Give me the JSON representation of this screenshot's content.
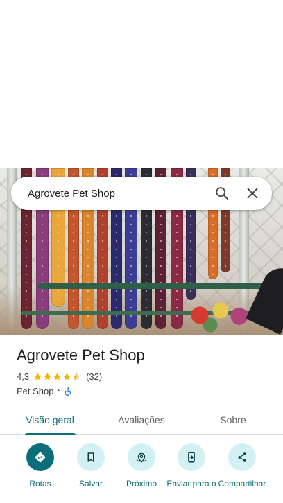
{
  "search": {
    "query": "Agrovete Pet Shop"
  },
  "place": {
    "name": "Agrovete Pet Shop",
    "rating": "4,3",
    "rating_value": 4.3,
    "review_count": "(32)",
    "category": "Pet Shop",
    "separator": "•"
  },
  "tabs": [
    {
      "label": "Visão geral",
      "active": true
    },
    {
      "label": "Avaliações",
      "active": false
    },
    {
      "label": "Sobre",
      "active": false
    }
  ],
  "actions": [
    {
      "label": "Rotas",
      "icon": "directions-icon"
    },
    {
      "label": "Salvar",
      "icon": "bookmark-icon"
    },
    {
      "label": "Próximo",
      "icon": "nearby-icon"
    },
    {
      "label": "Enviar para o",
      "icon": "send-to-phone-icon"
    },
    {
      "label": "Compartilhar",
      "icon": "share-icon"
    }
  ],
  "colors": {
    "accent": "#0b6e7a",
    "action_bg": "#d3f1f5",
    "star": "#f4b400"
  }
}
